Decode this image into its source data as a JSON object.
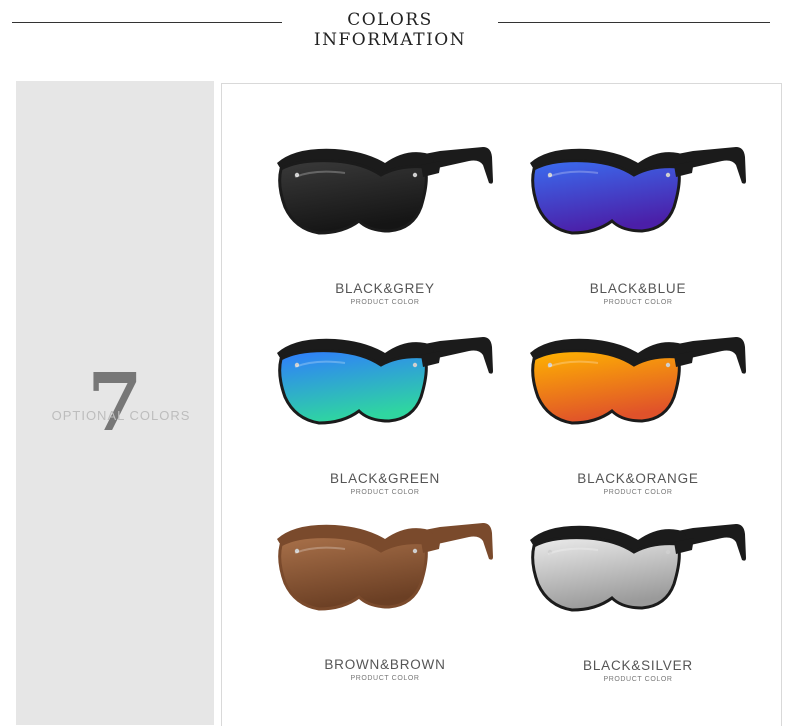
{
  "header": {
    "title": "COLORS INFORMATION"
  },
  "sidebar": {
    "count": "7",
    "caption": "OPTIONAL COLORS"
  },
  "colors": [
    {
      "name": "BLACK&GREY",
      "sub": "PRODUCT COLOR",
      "frame": "#1b1b1b",
      "lens_top": "#3a3a3a",
      "lens_bottom": "#151515",
      "icon": "sunglasses-grey-icon"
    },
    {
      "name": "BLACK&BLUE",
      "sub": "PRODUCT COLOR",
      "frame": "#1b1b1b",
      "lens_top": "#3a6df0",
      "lens_bottom": "#4b1fa8",
      "icon": "sunglasses-blue-icon"
    },
    {
      "name": "BLACK&GREEN",
      "sub": "PRODUCT COLOR",
      "frame": "#1b1b1b",
      "lens_top": "#2f7bff",
      "lens_bottom": "#2fd6a0",
      "icon": "sunglasses-green-icon"
    },
    {
      "name": "BLACK&ORANGE",
      "sub": "PRODUCT COLOR",
      "frame": "#1b1b1b",
      "lens_top": "#ffb400",
      "lens_bottom": "#e0522a",
      "icon": "sunglasses-orange-icon"
    },
    {
      "name": "BROWN&BROWN",
      "sub": "PRODUCT COLOR",
      "frame": "#7a4a2c",
      "lens_top": "#a9714a",
      "lens_bottom": "#6b3f24",
      "icon": "sunglasses-brown-icon"
    },
    {
      "name": "BLACK&SILVER",
      "sub": "PRODUCT COLOR",
      "frame": "#1b1b1b",
      "lens_top": "#ececec",
      "lens_bottom": "#9a9a9a",
      "icon": "sunglasses-silver-icon"
    }
  ]
}
